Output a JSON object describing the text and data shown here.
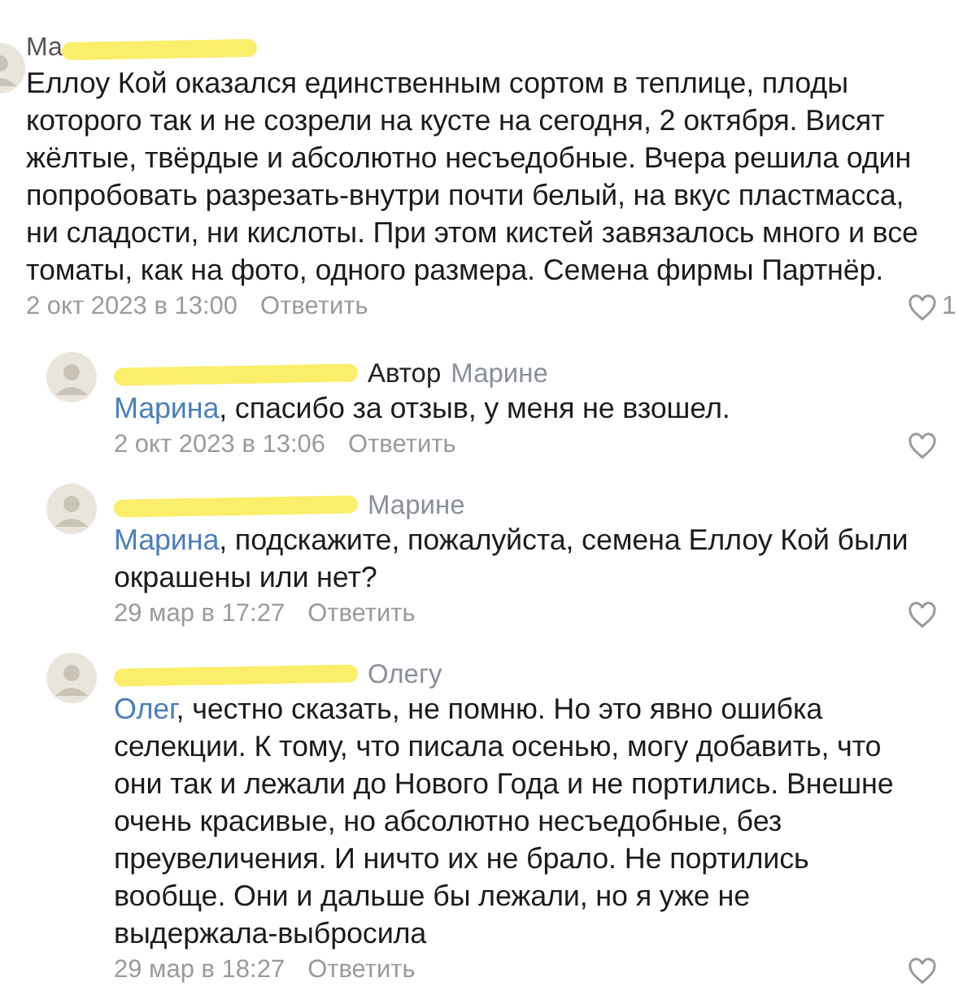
{
  "comments": [
    {
      "author": "Ма",
      "text": "Еллоу Кой оказался единственным сортом в теплице, плоды которого так и не созрели на кусте на сегодня, 2 октября. Висят жёлтые, твёрдые и абсолютно несъедобные. Вчера решила один попробовать разрезать-внутри почти белый, на вкус пластмасса, ни сладости, ни кислоты. При этом кистей завязалось много и все томаты, как на фото, одного размера. Семена фирмы Партнёр.",
      "date": "2 окт 2023 в 13:00",
      "reply": "Ответить",
      "likes": "1",
      "replies": [
        {
          "badge": "Автор",
          "addressee": "Марине",
          "mention": "Марина",
          "text": ", спасибо за отзыв, у меня не взошел.",
          "date": "2 окт 2023 в 13:06",
          "reply": "Ответить"
        },
        {
          "addressee": "Марине",
          "mention": "Марина",
          "text": ", подскажите, пожалуйста, семена Еллоу Кой были окрашены или нет?",
          "date": "29 мар в 17:27",
          "reply": "Ответить"
        },
        {
          "addressee": "Олегу",
          "mention": "Олег",
          "text": ", честно сказать, не помню. Но это явно ошибка селекции. К тому, что писала осенью, могу добавить, что они так и лежали до Нового Года и не портились. Внешне очень красивые, но абсолютно несъедобные, без преувеличения. И ничто их не брало. Не портились вообще. Они и дальше бы лежали, но я уже не выдержала-выбросила",
          "date": "29 мар в 18:27",
          "reply": "Ответить"
        }
      ]
    }
  ]
}
